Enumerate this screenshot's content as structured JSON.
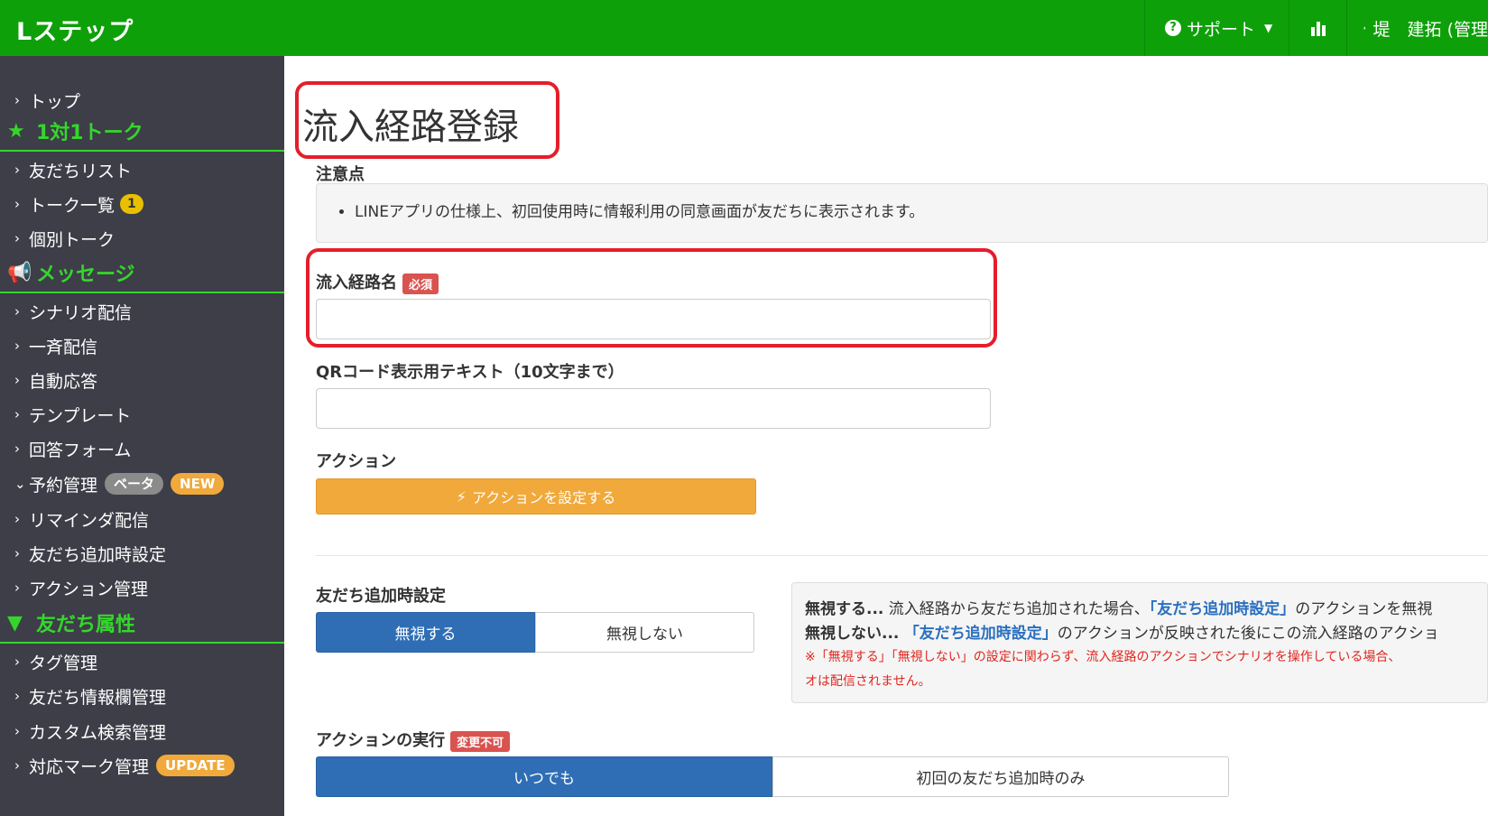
{
  "header": {
    "brand": "Lステップ",
    "support_label": "サポート",
    "user_label": "堤　建拓 (管理"
  },
  "sidebar": {
    "top": "トップ",
    "section_talk": "1対1トーク",
    "friends_list": "友だちリスト",
    "talk_list": "トーク一覧",
    "talk_badge": "1",
    "individual_talk": "個別トーク",
    "section_message": "メッセージ",
    "scenario": "シナリオ配信",
    "broadcast": "一斉配信",
    "auto_reply": "自動応答",
    "template": "テンプレート",
    "form": "回答フォーム",
    "reservation": "予約管理",
    "beta_badge": "ベータ",
    "new_badge": "NEW",
    "reminder": "リマインダ配信",
    "friend_add_settings": "友だち追加時設定",
    "action_mgmt": "アクション管理",
    "section_attr": "友だち属性",
    "tag_mgmt": "タグ管理",
    "friend_info_mgmt": "友だち情報欄管理",
    "custom_search": "カスタム検索管理",
    "mark_mgmt": "対応マーク管理",
    "update_badge": "UPDATE"
  },
  "main": {
    "title": "流入経路登録",
    "notice_label": "注意点",
    "notice_item": "LINEアプリの仕様上、初回使用時に情報利用の同意画面が友だちに表示されます。",
    "route_name_label": "流入経路名",
    "required_badge": "必須",
    "route_name_value": "",
    "qr_text_label": "QRコード表示用テキスト（10文字まで）",
    "qr_text_value": "",
    "action_label": "アクション",
    "action_button": "アクションを設定する",
    "friend_add_label": "友だち追加時設定",
    "ignore_on": "無視する",
    "ignore_off": "無視しない",
    "info_line1_head": "無視する...",
    "info_line1_a": " 流入経路から友だち追加された場合、",
    "info_line1_link": "「友だち追加時設定」",
    "info_line1_b": "のアクションを無視",
    "info_line2_head": "無視しない...",
    "info_line2_link": "「友だち追加時設定」",
    "info_line2_b": "のアクションが反映された後にこの流入経路のアクショ",
    "info_note1": "※「無視する」「無視しない」の設定に関わらず、流入経路のアクションでシナリオを操作している場合、",
    "info_note2": "オは配信されません。",
    "exec_label": "アクションの実行",
    "immutable_badge": "変更不可",
    "exec_always": "いつでも",
    "exec_first": "初回の友だち追加時のみ"
  },
  "colors": {
    "brand_green": "#0ea009",
    "sidebar_bg": "#3d3e48",
    "section_green": "#35d62c",
    "primary_blue": "#2f6eb5",
    "action_orange": "#f0a93a",
    "highlight_red": "#e51e2a"
  }
}
